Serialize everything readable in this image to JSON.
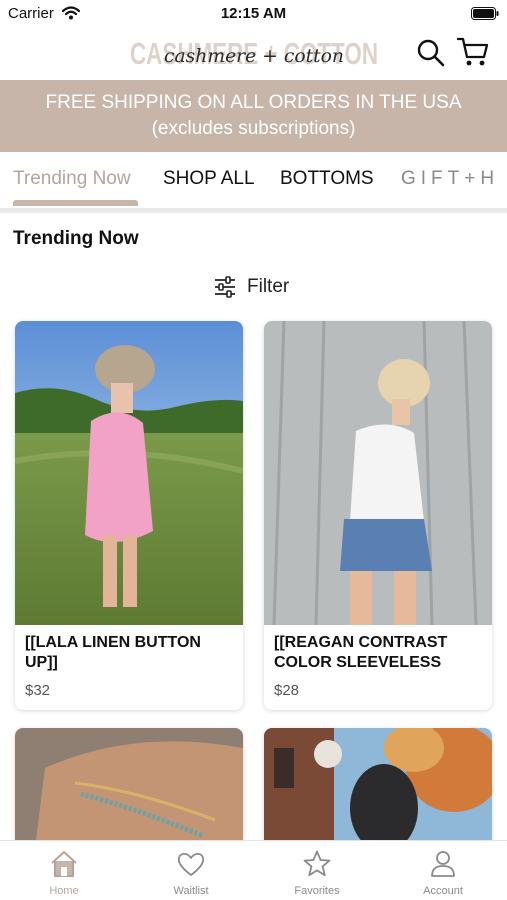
{
  "status_bar": {
    "carrier": "Carrier",
    "time": "12:15 AM"
  },
  "header": {
    "brand": "CASHMERE + COTTON",
    "brand_script": "cashmere + cotton"
  },
  "banner": {
    "text": "FREE SHIPPING ON ALL ORDERS IN THE USA (excludes subscriptions)"
  },
  "tabs": [
    {
      "label": "Trending Now",
      "active": true
    },
    {
      "label": "SHOP ALL"
    },
    {
      "label": "BOTTOMS"
    },
    {
      "label": "GIFT+H"
    }
  ],
  "section": {
    "title": "Trending Now",
    "filter_label": "Filter"
  },
  "products": [
    {
      "name": "[[LALA LINEN BUTTON UP]]",
      "price": "$32"
    },
    {
      "name": "[[REAGAN CONTRAST COLOR SLEEVELESS",
      "price": "$28"
    }
  ],
  "tab_bar": {
    "items": [
      {
        "label": "Home",
        "icon": "home-icon",
        "active": true
      },
      {
        "label": "Waitlist",
        "icon": "heart-icon"
      },
      {
        "label": "Favorites",
        "icon": "star-icon"
      },
      {
        "label": "Account",
        "icon": "person-icon"
      }
    ]
  },
  "colors": {
    "accent": "#c7b5aa",
    "accent_text": "#b5a49a",
    "divider": "#e9e9e9"
  }
}
